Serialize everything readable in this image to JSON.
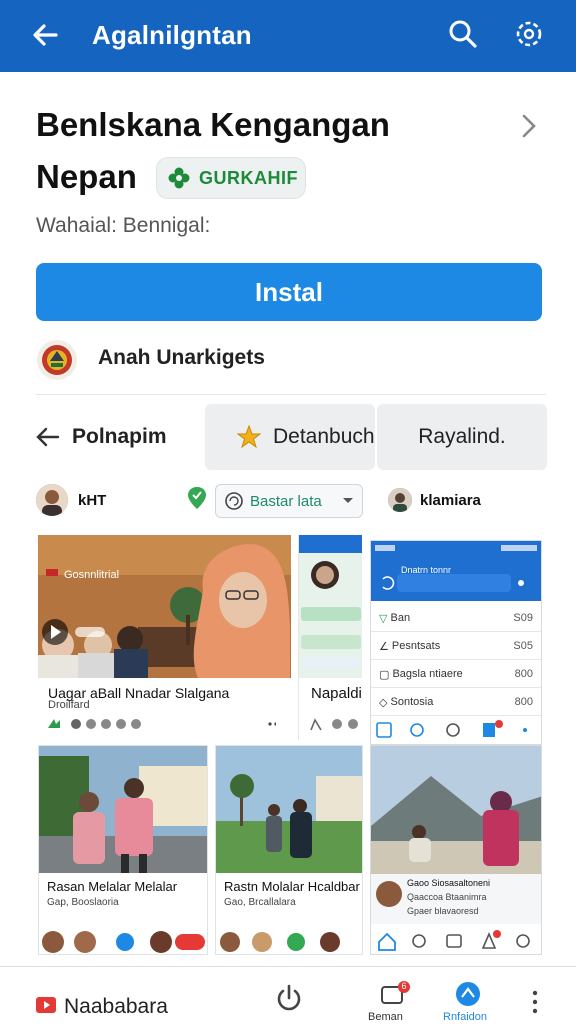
{
  "topbar": {
    "title": "Agalnilgntan"
  },
  "app": {
    "title_line1": "Benlskana Kengangan",
    "title_line2": "Nepan",
    "badge": "GURKAHIF",
    "subtitle": "Wahaial: Bennigal:",
    "install_label": "Instal",
    "related_label": "Anah Unarkigets"
  },
  "tabs": [
    {
      "label": "Polnapim"
    },
    {
      "label": "Detanbuch"
    },
    {
      "label": "Rayalind."
    }
  ],
  "filterbar": {
    "user1": "kHT",
    "dropdown_label": "Bastar lata",
    "user2": "klamiara"
  },
  "cards": {
    "c1_line1": "Uagar aBall Nnadar Slalgana",
    "c1_line2": "Droilfard",
    "c1_overlay": "Gosnnlitrial",
    "c2_title": "Napaldi",
    "c3_header": "Dnatrn tonnr",
    "c3_rows": [
      {
        "label": "Ban",
        "value": "S09"
      },
      {
        "label": "Pesntsats",
        "value": "S05"
      },
      {
        "label": "Bagsla ntiaere",
        "value": "800"
      },
      {
        "label": "Sontosia",
        "value": "800"
      }
    ],
    "c4_title": "Rasan Melalar Melalar",
    "c4_sub": "Gap, Booslaoria",
    "c5_title": "Rastn Molalar Hcaldbar",
    "c5_sub": "Gao, Brcallalara",
    "c6_line1": "Gaoo Siosasaltoneni",
    "c6_line2": "Qaaccoa Btaanimra",
    "c6_line3": "Gpaer blavaoresd"
  },
  "bottombar": {
    "brand": "Naababara",
    "nav1_label": "Beman",
    "nav1_badge": "6",
    "nav2_label": "Rnfaidon"
  },
  "colors": {
    "topbar": "#1565c0",
    "install": "#1e88e5",
    "accent_green": "#1d8a3a"
  }
}
